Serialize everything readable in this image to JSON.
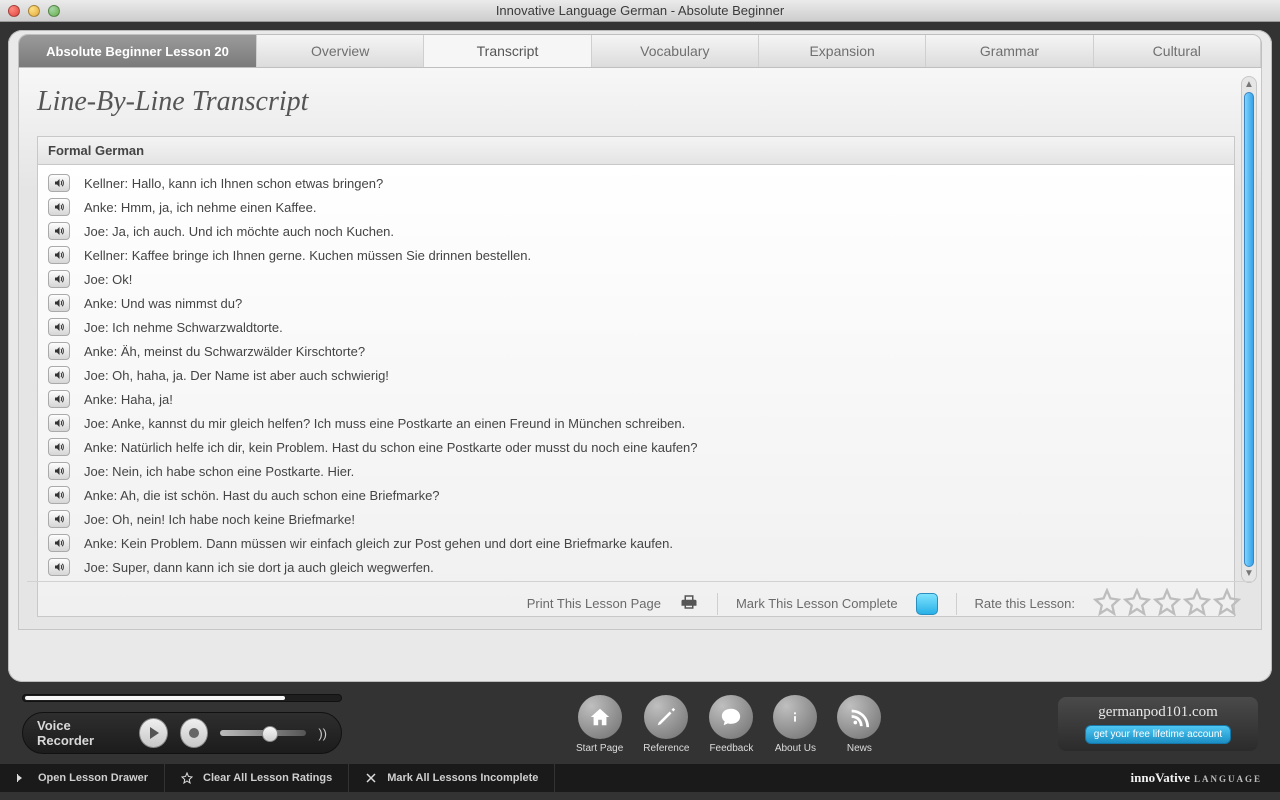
{
  "window": {
    "title": "Innovative Language German - Absolute Beginner"
  },
  "tabs": {
    "lesson": "Absolute Beginner Lesson 20",
    "items": [
      "Overview",
      "Transcript",
      "Vocabulary",
      "Expansion",
      "Grammar",
      "Cultural"
    ],
    "active_index": 1
  },
  "page": {
    "title": "Line-By-Line Transcript"
  },
  "section": {
    "header": "Formal German"
  },
  "lines": [
    "Kellner: Hallo, kann ich Ihnen schon etwas bringen?",
    "Anke: Hmm, ja, ich nehme einen Kaffee.",
    "Joe: Ja, ich auch. Und ich möchte auch noch Kuchen.",
    "Kellner: Kaffee bringe ich Ihnen gerne. Kuchen müssen Sie drinnen bestellen.",
    "Joe: Ok!",
    "Anke: Und was nimmst du?",
    "Joe: Ich nehme Schwarzwaldtorte.",
    "Anke: Äh, meinst du Schwarzwälder Kirschtorte?",
    "Joe: Oh, haha, ja. Der Name ist aber auch schwierig!",
    "Anke: Haha, ja!",
    "Joe: Anke, kannst du mir gleich helfen? Ich muss eine Postkarte an einen Freund in München schreiben.",
    "Anke: Natürlich helfe ich dir, kein Problem. Hast du schon eine Postkarte oder musst du noch eine kaufen?",
    "Joe: Nein, ich habe schon eine Postkarte. Hier.",
    "Anke: Ah, die ist schön. Hast du auch schon eine Briefmarke?",
    "Joe: Oh, nein! Ich habe noch keine Briefmarke!",
    "Anke: Kein Problem. Dann müssen wir einfach gleich zur Post gehen und dort eine Briefmarke kaufen.",
    "Joe: Super, dann kann ich sie dort ja auch gleich wegwerfen."
  ],
  "footer": {
    "print": "Print This Lesson Page",
    "mark_complete": "Mark This Lesson Complete",
    "rate_label": "Rate this Lesson:"
  },
  "recorder": {
    "label": "Voice Recorder"
  },
  "dock": {
    "items": [
      {
        "label": "Start Page",
        "icon": "home"
      },
      {
        "label": "Reference",
        "icon": "pen"
      },
      {
        "label": "Feedback",
        "icon": "chat"
      },
      {
        "label": "About Us",
        "icon": "info"
      },
      {
        "label": "News",
        "icon": "rss"
      }
    ]
  },
  "brand": {
    "site": "germanpod101.com",
    "cta": "get your free lifetime account"
  },
  "status": {
    "open_drawer": "Open Lesson Drawer",
    "clear_ratings": "Clear All Lesson Ratings",
    "mark_incomplete": "Mark All Lessons Incomplete",
    "logo_main": "innoVative",
    "logo_sub": "LANGUAGE"
  }
}
